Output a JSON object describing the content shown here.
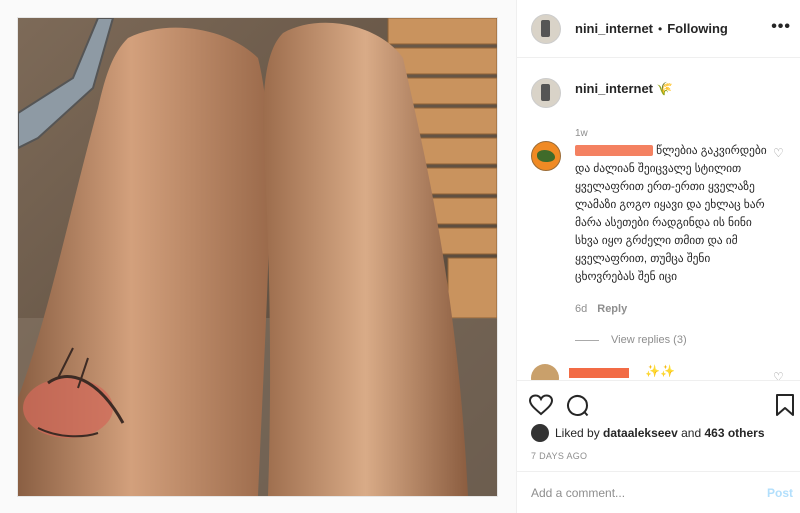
{
  "post": {
    "username": "nini_internet",
    "separator": "•",
    "follow_status": "Following",
    "more_glyph": "•••"
  },
  "caption": {
    "username": "nini_internet",
    "emoji": "🌾",
    "time": "1w"
  },
  "comments": [
    {
      "text": "წლებია გაკვირდები და ძალიან შეიცვალე სტილით ყველაფრით ერთ-ერთი ყველაზე ლამაზი გოგო იყავი და ეხლაც ხარ მარა ასეთები რადგინდა ის ნინი სხვა იყო გრძელი თმით და იმ ყველაფრით, თუმცა შენი ცხოვრებას შენ იცი",
      "time": "6d",
      "reply_label": "Reply",
      "view_replies": "View replies (3)"
    },
    {
      "text": "✨✨"
    }
  ],
  "footer": {
    "liked_by_prefix": "Liked by",
    "liked_by_user": "dataalekseev",
    "and_label": "and",
    "others_count": "463 others",
    "date": "7 DAYS AGO",
    "comment_placeholder": "Add a comment...",
    "post_label": "Post"
  },
  "colors": {
    "accent": "#0095f6",
    "post_disabled": "#b2dffc",
    "redaction": "#f26b45"
  },
  "icons": [
    "heart-icon",
    "comment-icon",
    "bookmark-icon",
    "more-options-icon"
  ]
}
